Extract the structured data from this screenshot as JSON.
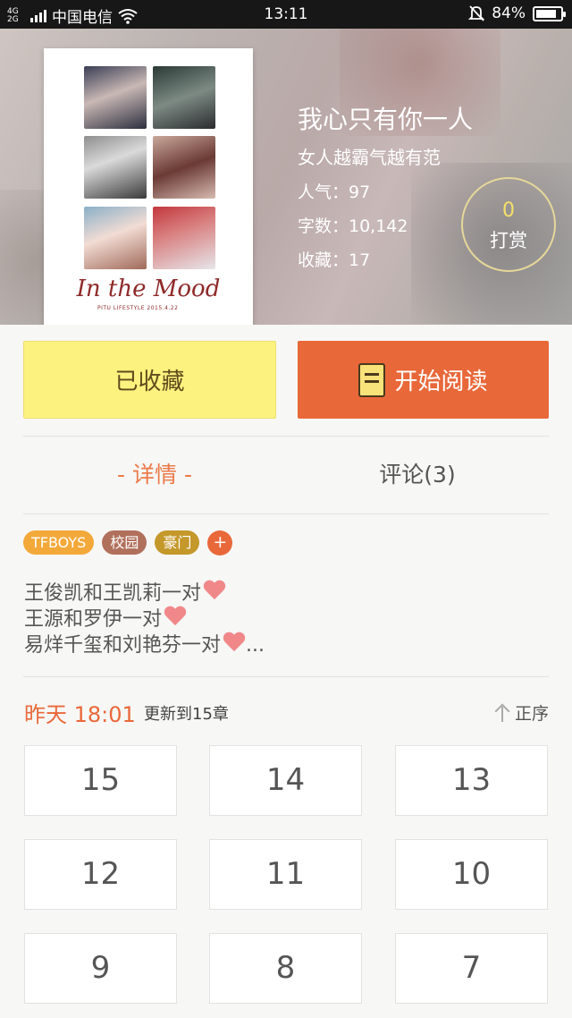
{
  "status_bar": {
    "network": "4G 2G",
    "carrier": "中国电信",
    "time": "13:11",
    "battery": "84%",
    "battery_level": 0.84
  },
  "book": {
    "title": "我心只有你一人",
    "author": "女人越霸气越有范",
    "popularity": "人气：97",
    "word_count": "字数：10,142",
    "favorites": "收藏：17",
    "cover_title": "In the Mood",
    "cover_subtitle": "PITU LIFESTYLE 2015.4.22"
  },
  "tip": {
    "count": "0",
    "label": "打赏"
  },
  "actions": {
    "collected": "已收藏",
    "start_reading": "开始阅读"
  },
  "tabs": {
    "details": "- 详情 -",
    "comments": "评论(3)"
  },
  "tags": [
    {
      "label": "TFBOYS",
      "color": "#f3a93a"
    },
    {
      "label": "校园",
      "color": "#b0705c"
    },
    {
      "label": "豪门",
      "color": "#c4982a"
    }
  ],
  "tag_add": "+",
  "description": [
    "王俊凯和王凯莉一对",
    "王源和罗伊一对",
    "易烊千玺和刘艳芬一对"
  ],
  "description_ellipsis": "...",
  "update": {
    "when": "昨天 18:01",
    "text": "更新到15章",
    "sort": "正序"
  },
  "chapters": [
    "15",
    "14",
    "13",
    "12",
    "11",
    "10",
    "9",
    "8",
    "7"
  ],
  "colors": {
    "accent": "#e9683a",
    "collected_bg": "#fcf27f",
    "tip_ring": "#e6d79a"
  }
}
